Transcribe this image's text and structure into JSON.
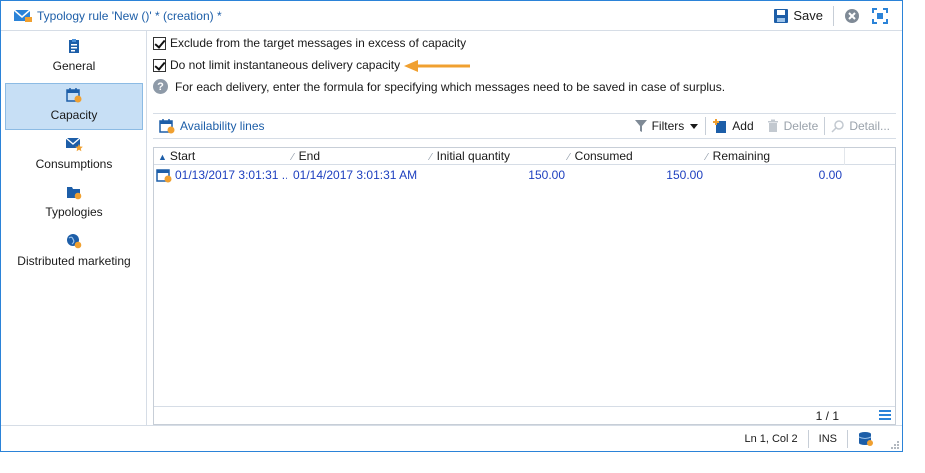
{
  "window": {
    "title": "Typology rule 'New ()' * (creation) *",
    "save_label": "Save"
  },
  "sidebar": {
    "items": [
      {
        "label": "General",
        "icon": "clipboard-icon"
      },
      {
        "label": "Capacity",
        "icon": "calendar-icon",
        "active": true
      },
      {
        "label": "Consumptions",
        "icon": "envelope-star-icon"
      },
      {
        "label": "Typologies",
        "icon": "folder-icon"
      },
      {
        "label": "Distributed marketing",
        "icon": "globe-icon"
      }
    ]
  },
  "options": {
    "exclude_label": "Exclude from the target messages in excess of capacity",
    "exclude_checked": true,
    "nolimit_label": "Do not limit instantaneous delivery capacity",
    "nolimit_checked": true,
    "help_text": "For each delivery, enter the formula for specifying which messages need to be saved in case of surplus."
  },
  "availability": {
    "title": "Availability lines",
    "filters_label": "Filters",
    "add_label": "Add",
    "delete_label": "Delete",
    "detail_label": "Detail..."
  },
  "grid": {
    "columns": [
      "Start",
      "End",
      "Initial quantity",
      "Consumed",
      "Remaining"
    ],
    "rows": [
      {
        "start": "01/13/2017 3:01:31 ...",
        "end": "01/14/2017 3:01:31 AM",
        "initial": "150.00",
        "consumed": "150.00",
        "remaining": "0.00"
      }
    ],
    "pager": "1 / 1"
  },
  "status": {
    "position": "Ln 1, Col 2",
    "mode": "INS"
  },
  "colors": {
    "accent": "#1d5ea8",
    "link": "#1d3fbf",
    "active_bg": "#c7dff5",
    "arrow": "#f0a030"
  }
}
